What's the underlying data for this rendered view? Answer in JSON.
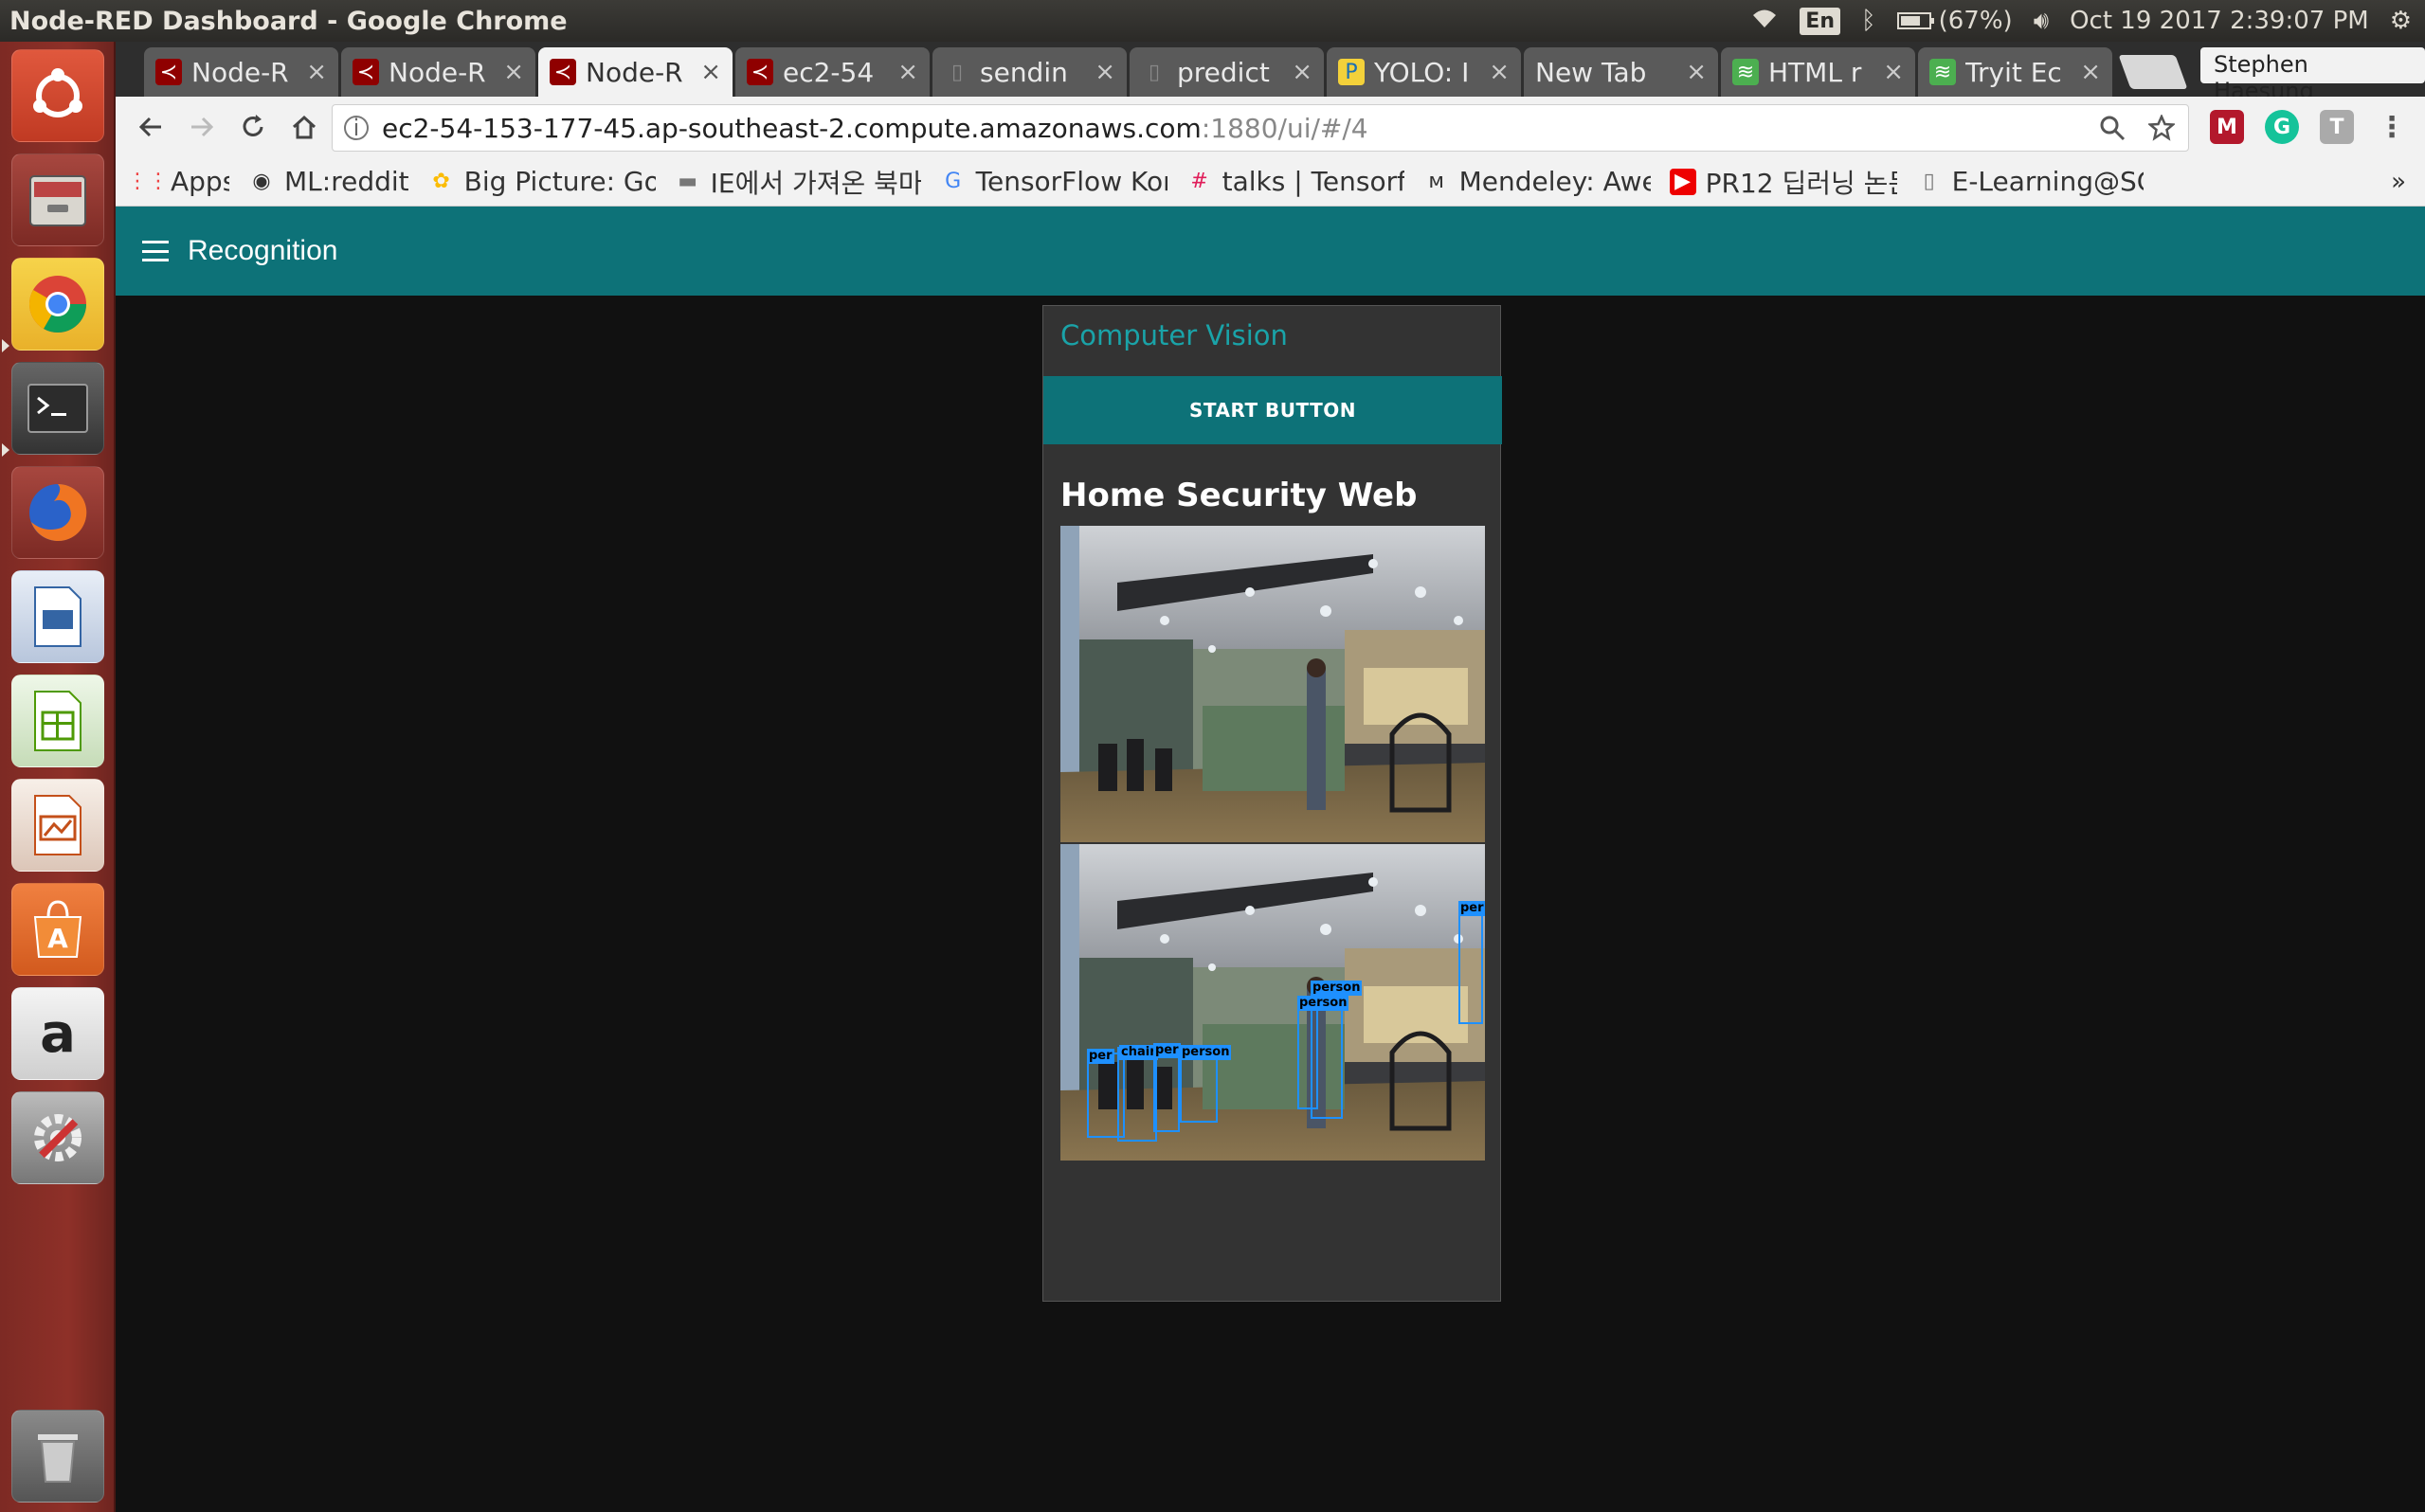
{
  "window": {
    "title": "Node-RED Dashboard - Google Chrome"
  },
  "system_panel": {
    "keyboard": "En",
    "battery": "(67%)",
    "datetime": "Oct 19 2017  2:39:07 PM"
  },
  "tabs": [
    {
      "label": "Node-R",
      "icon": "node-red-icon",
      "active": false
    },
    {
      "label": "Node-R",
      "icon": "node-red-icon",
      "active": false
    },
    {
      "label": "Node-R",
      "icon": "node-red-icon",
      "active": true
    },
    {
      "label": "ec2-54",
      "icon": "node-red-icon",
      "active": false
    },
    {
      "label": "sendin",
      "icon": "page-icon",
      "active": false
    },
    {
      "label": "predict",
      "icon": "page-icon",
      "active": false
    },
    {
      "label": "YOLO: I",
      "icon": "yolo-icon",
      "active": false
    },
    {
      "label": "New Tab",
      "icon": "none",
      "active": false
    },
    {
      "label": "HTML r",
      "icon": "tryit-icon",
      "active": false
    },
    {
      "label": "Tryit Ec",
      "icon": "tryit-icon",
      "active": false
    }
  ],
  "profile_name": "Stephen Haesung",
  "address_bar": {
    "host": "ec2-54-153-177-45.ap-southeast-2.compute.amazonaws.com",
    "path": ":1880/ui/#/4"
  },
  "bookmarks": [
    {
      "label": "Apps",
      "icon": "apps-grid-icon"
    },
    {
      "label": "ML:reddit",
      "icon": "reddit-icon"
    },
    {
      "label": "Big Picture: Goo",
      "icon": "google-photos-icon"
    },
    {
      "label": "IE에서 가져온 북마",
      "icon": "folder-icon"
    },
    {
      "label": "TensorFlow Kore",
      "icon": "google-icon"
    },
    {
      "label": "talks | Tensorflo",
      "icon": "slack-icon"
    },
    {
      "label": "Mendeley: Awes",
      "icon": "mendeley-icon"
    },
    {
      "label": "PR12 딥러닝 논문",
      "icon": "youtube-icon"
    },
    {
      "label": "E-Learning@SCB",
      "icon": "page-icon"
    }
  ],
  "dashboard": {
    "header_title": "Recognition",
    "group_title": "Computer Vision",
    "start_button": "START BUTTON",
    "section_title": "Home Security Web",
    "detections": [
      {
        "label": "per"
      },
      {
        "label": "person"
      },
      {
        "label": "person"
      },
      {
        "label": "per"
      },
      {
        "label": "chair"
      },
      {
        "label": "per"
      },
      {
        "label": "person"
      }
    ]
  },
  "colors": {
    "dashboard_teal": "#0d7278",
    "group_title": "#1aa3a8",
    "detection_box": "#1e90ff",
    "launcher_red": "#8e3028"
  }
}
